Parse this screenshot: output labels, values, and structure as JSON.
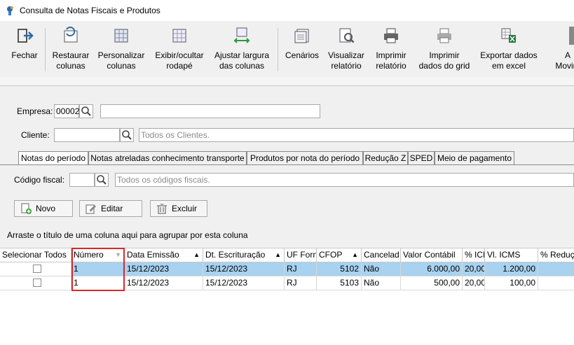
{
  "window": {
    "title": "Consulta de Notas Fiscais e Produtos -",
    "icon": "app-icon"
  },
  "toolbar": {
    "buttons": [
      {
        "label": "Fechar",
        "icon": "exit-icon"
      },
      {
        "label": "Restaurar\ncolunas",
        "icon": "restore-columns-icon"
      },
      {
        "label": "Personalizar\ncolunas",
        "icon": "customize-columns-icon"
      },
      {
        "label": "Exibir/ocultar\nrodapé",
        "icon": "footer-toggle-icon"
      },
      {
        "label": "Ajustar largura\ndas colunas",
        "icon": "column-width-icon"
      },
      {
        "label": "Cenários",
        "icon": "scenarios-icon"
      },
      {
        "label": "Visualizar\nrelatório",
        "icon": "report-preview-icon"
      },
      {
        "label": "Imprimir\nrelatório",
        "icon": "print-report-icon"
      },
      {
        "label": "Imprimir\ndados do grid",
        "icon": "print-grid-icon"
      },
      {
        "label": "Exportar dados\nem excel",
        "icon": "excel-export-icon"
      },
      {
        "label": "A\nMovim",
        "icon": "more-icon"
      }
    ]
  },
  "filters": {
    "empresa_label": "Empresa:",
    "empresa_code": "00002",
    "cliente_label": "Cliente:",
    "cliente_placeholder": "Todos os Clientes.",
    "codigo_fiscal_label": "Código fiscal:",
    "codigo_fiscal_placeholder": "Todos os códigos fiscais."
  },
  "tabs": [
    "Notas do período",
    "Notas atreladas conhecimento transporte",
    "Produtos por nota do período",
    "Redução Z",
    "SPED",
    "Meio de pagamento"
  ],
  "actions": {
    "novo": "Novo",
    "editar": "Editar",
    "excluir": "Excluir"
  },
  "group_hint": "Arraste o título de uma coluna aqui para agrupar por esta coluna",
  "grid": {
    "columns": [
      "Selecionar Todos",
      "Número",
      "Data Emissão",
      "Dt. Escrituração",
      "UF Forn",
      "CFOP",
      "Cancelad",
      "Valor Contábil",
      "% ICN",
      "Vl. ICMS",
      "% Reduçã"
    ],
    "rows": [
      {
        "numero": "1",
        "data_emissao": "15/12/2023",
        "dt_escrituracao": "15/12/2023",
        "uf": "RJ",
        "cfop": "5102",
        "cancelada": "Não",
        "valor_contabil": "6.000,00",
        "pct_icms": "20,00",
        "vl_icms": "1.200,00",
        "pct_reducao": ""
      },
      {
        "numero": "1",
        "data_emissao": "15/12/2023",
        "dt_escrituracao": "15/12/2023",
        "uf": "RJ",
        "cfop": "5103",
        "cancelada": "Não",
        "valor_contabil": "500,00",
        "pct_icms": "20,00",
        "vl_icms": "100,00",
        "pct_reducao": ""
      }
    ]
  },
  "colors": {
    "selected_row": "#a8d2f0",
    "highlight_border": "#d9282b"
  }
}
